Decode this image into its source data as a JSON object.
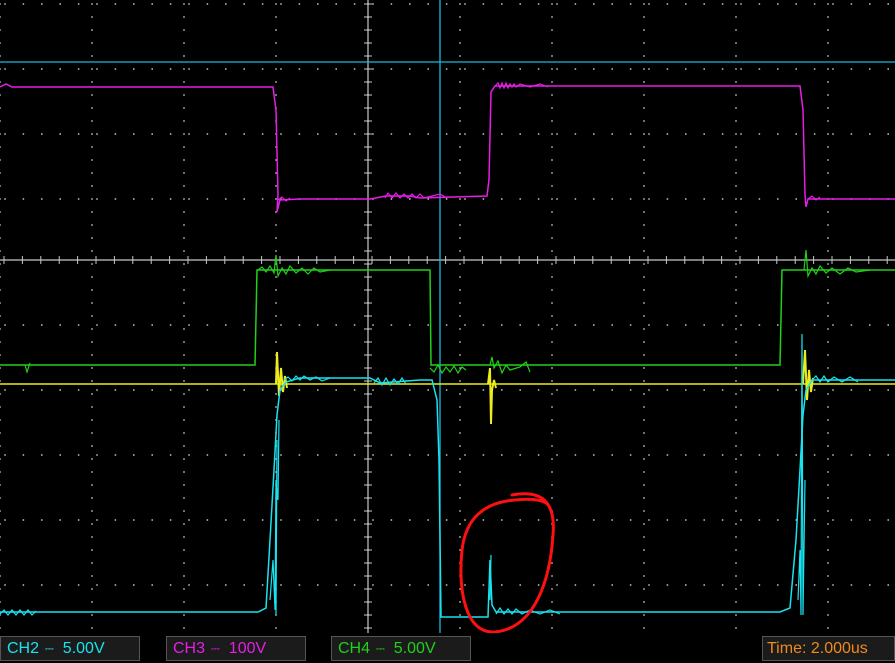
{
  "colors": {
    "ch2": "#19e3f0",
    "ch3": "#e61ee6",
    "ch4": "#22d01b",
    "yellow_trace": "#ecec1a",
    "cursor": "#1ab8e0",
    "grid": "#c8c8c8",
    "time": "#f08a1c"
  },
  "channels": [
    {
      "id": "CH2",
      "coupling_icon": "dc-coupling-icon",
      "scale": "5.00V"
    },
    {
      "id": "CH3",
      "coupling_icon": "dc-coupling-icon",
      "scale": "100V"
    },
    {
      "id": "CH4",
      "coupling_icon": "dc-coupling-icon",
      "scale": "5.00V"
    }
  ],
  "timebase": {
    "label": "Time:",
    "value": "2.000us"
  },
  "annotation": {
    "type": "hand-drawn circle",
    "color": "#ff0000"
  }
}
